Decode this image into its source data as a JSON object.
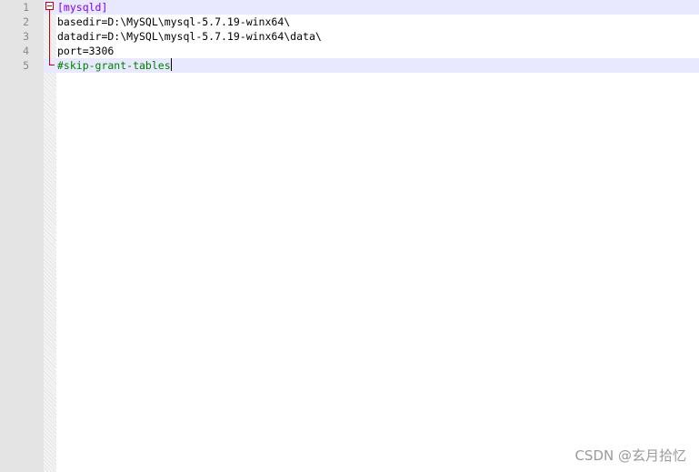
{
  "editor": {
    "line_numbers": [
      "1",
      "2",
      "3",
      "4",
      "5"
    ],
    "lines": [
      "[mysqld]",
      "basedir=D:\\MySQL\\mysql-5.7.19-winx64\\",
      "datadir=D:\\MySQL\\mysql-5.7.19-winx64\\data\\",
      "port=3306",
      "#skip-grant-tables"
    ],
    "current_line": 5
  },
  "colors": {
    "section_header": "#8000ff",
    "comment": "#008000",
    "fold_marker": "#cc0000",
    "current_line_highlight": "#e8e8ff"
  },
  "watermark": "CSDN @玄月拾忆"
}
